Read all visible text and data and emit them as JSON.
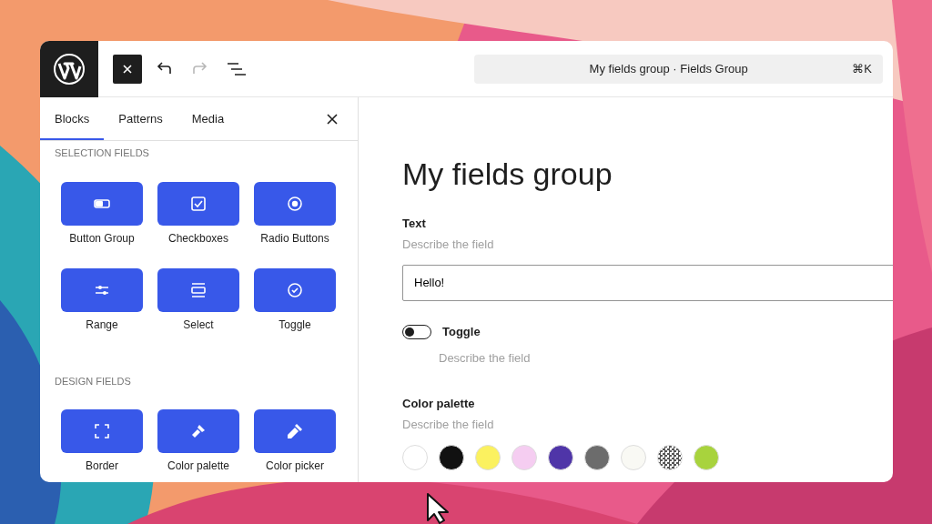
{
  "toolbar": {
    "undo": {
      "disabled": false
    },
    "redo": {
      "disabled": true
    }
  },
  "command_bar": {
    "title": "My fields group · Fields Group",
    "shortcut": "⌘K"
  },
  "inserter": {
    "tabs": [
      {
        "label": "Blocks",
        "selected": true
      },
      {
        "label": "Patterns",
        "selected": false
      },
      {
        "label": "Media",
        "selected": false
      }
    ],
    "sections": [
      {
        "heading": "SELECTION FIELDS",
        "blocks": [
          {
            "label": "Button Group"
          },
          {
            "label": "Checkboxes"
          },
          {
            "label": "Radio Buttons"
          },
          {
            "label": "Range"
          },
          {
            "label": "Select"
          },
          {
            "label": "Toggle"
          }
        ]
      },
      {
        "heading": "DESIGN FIELDS",
        "blocks": [
          {
            "label": "Border"
          },
          {
            "label": "Color palette"
          },
          {
            "label": "Color picker"
          }
        ]
      }
    ]
  },
  "editor": {
    "title": "My fields group",
    "fields": [
      {
        "kind": "text",
        "label": "Text",
        "help": "Describe the field",
        "value": "Hello!"
      },
      {
        "kind": "toggle",
        "label": "Toggle",
        "help": "Describe the field",
        "on": false
      },
      {
        "kind": "palette",
        "label": "Color palette",
        "help": "Describe the field",
        "swatches": [
          {
            "kind": "solid",
            "color": "#ffffff"
          },
          {
            "kind": "solid",
            "color": "#111111"
          },
          {
            "kind": "solid",
            "color": "#fbf15f"
          },
          {
            "kind": "solid",
            "color": "#f5cdf1"
          },
          {
            "kind": "solid",
            "color": "#4f35a8"
          },
          {
            "kind": "solid",
            "color": "#6c6c6c"
          },
          {
            "kind": "solid",
            "color": "#f9f9f4"
          },
          {
            "kind": "pattern",
            "color": "#555555"
          },
          {
            "kind": "solid",
            "color": "#a8d33d"
          }
        ]
      }
    ]
  }
}
